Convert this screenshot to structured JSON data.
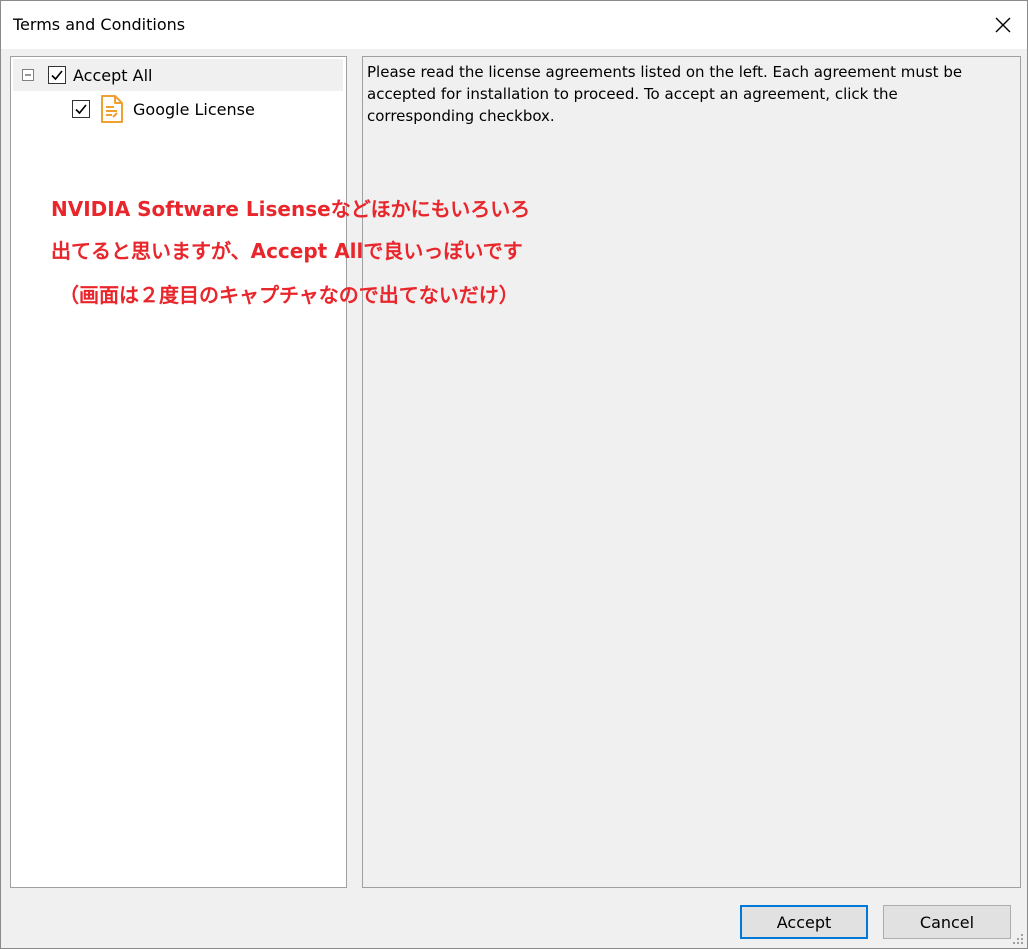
{
  "window": {
    "title": "Terms and Conditions"
  },
  "tree": {
    "root": {
      "label": "Accept All",
      "checked": true,
      "expanded": true
    },
    "children": [
      {
        "label": "Google License",
        "checked": true
      }
    ]
  },
  "description": {
    "text": "Please read the license agreements listed on the left. Each agreement must be accepted for installation to proceed. To accept an agreement, click the corresponding checkbox."
  },
  "annotation": {
    "line1": "NVIDIA Software Lisenseなどほかにもいろいろ",
    "line2": "出てると思いますが、Accept Allで良いっぽいです",
    "line3": "（画面は２度目のキャプチャなので出てないだけ）",
    "color": "#e8262b"
  },
  "buttons": {
    "accept": "Accept",
    "cancel": "Cancel"
  },
  "colors": {
    "accent": "#0078d7",
    "doc_icon": "#f0a030"
  }
}
